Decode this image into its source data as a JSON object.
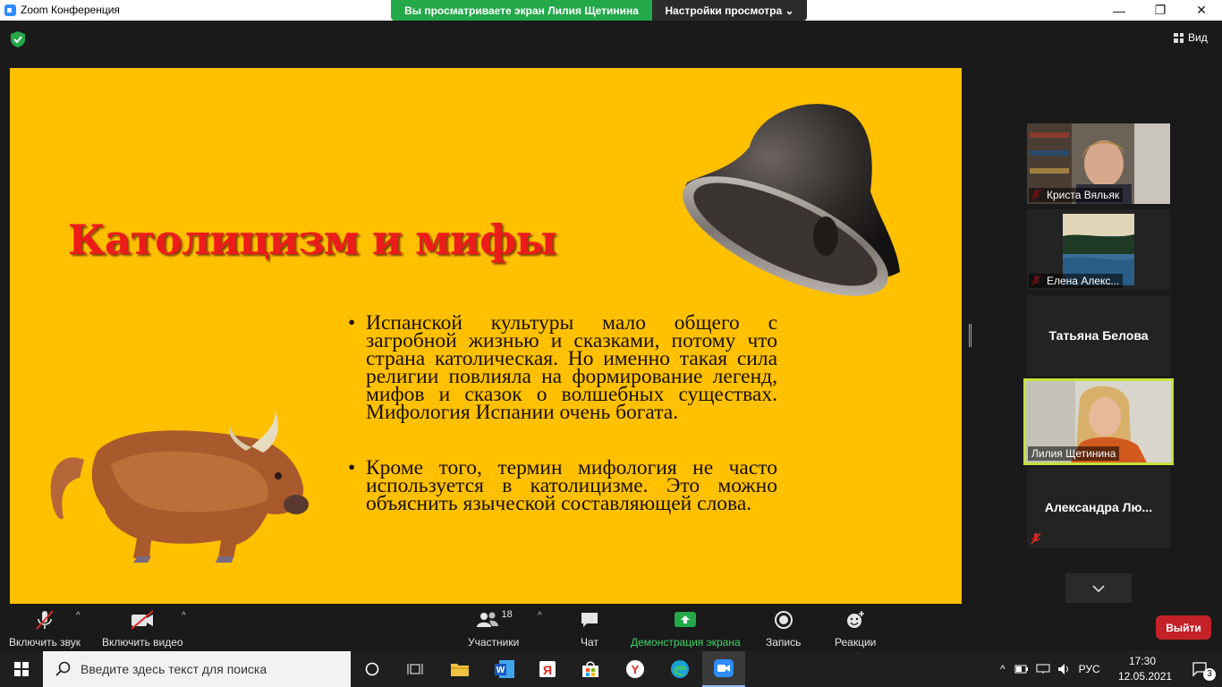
{
  "window": {
    "title": "Zoom Конференция",
    "minimize": "—",
    "maximize": "❐",
    "close": "✕"
  },
  "share_banner": {
    "viewing_text": "Вы просматриваете экран Лилия Щетинина",
    "view_settings": "Настройки просмотра ⌄"
  },
  "view_button": {
    "label": "Вид"
  },
  "slide": {
    "title": "Католицизм и мифы",
    "bullets": [
      "Испанской культуры мало общего с загробной жизнью и сказками, потому что страна католическая. Но именно такая сила религии повлияла на формирование легенд, мифов и сказок о волшебных существах. Мифология Испании очень богата.",
      "Кроме того, термин мифология не часто используется в католицизме. Это можно объяснить языческой составляющей слова."
    ]
  },
  "participants_panel": [
    {
      "name": "Криста Вяльяк",
      "muted": true,
      "video": true
    },
    {
      "name": "Елена Алекс...",
      "muted": true,
      "video": true
    },
    {
      "name": "Татьяна Белова",
      "muted": false,
      "video": false
    },
    {
      "name": "Лилия Щетинина",
      "muted": false,
      "video": true,
      "active_speaker": true
    },
    {
      "name": "Александра  Лю...",
      "muted": true,
      "video": false
    }
  ],
  "toolbar": {
    "unmute": "Включить звук",
    "start_video": "Включить видео",
    "participants": "Участники",
    "participants_count": "18",
    "chat": "Чат",
    "share_screen": "Демонстрация экрана",
    "record": "Запись",
    "reactions": "Реакции",
    "leave": "Выйти"
  },
  "taskbar": {
    "search_placeholder": "Введите здесь текст для поиска",
    "language": "РУС",
    "time": "17:30",
    "date": "12.05.2021",
    "notifications": "3"
  },
  "colors": {
    "slide_bg": "#ffc000",
    "title_red": "#ee1b1b",
    "share_green": "#23a84a",
    "leave_red": "#c42128",
    "active_speaker_border": "#c5e23c",
    "zoom_blue": "#2D8CFF"
  }
}
